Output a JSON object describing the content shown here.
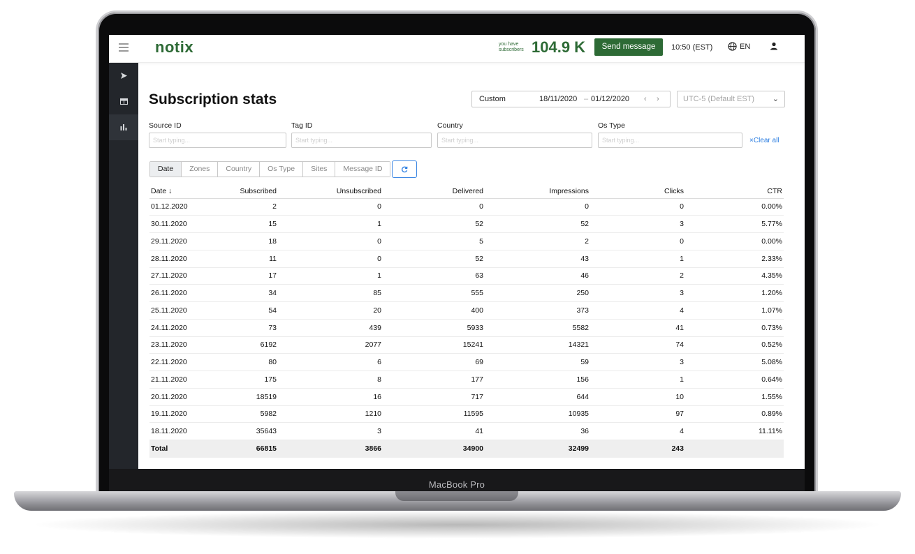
{
  "device": {
    "label": "MacBook Pro"
  },
  "header": {
    "logo": "notix",
    "subscribers_caption_line1": "you have",
    "subscribers_caption_line2": "subscribers",
    "subscribers_count": "104.9 K",
    "send_button": "Send message",
    "clock": "10:50 (EST)",
    "language": "EN"
  },
  "page": {
    "title": "Subscription stats"
  },
  "daterange": {
    "preset": "Custom",
    "from": "18/11/2020",
    "separator": "–",
    "to": "01/12/2020"
  },
  "timezone": {
    "value": "UTC-5 (Default EST)"
  },
  "filters": {
    "source_id": {
      "label": "Source ID",
      "placeholder": "Start typing..."
    },
    "tag_id": {
      "label": "Tag ID",
      "placeholder": "Start typing..."
    },
    "country": {
      "label": "Country",
      "placeholder": "Start typing..."
    },
    "os_type": {
      "label": "Os Type",
      "placeholder": "Start typing..."
    },
    "clear_all": "Clear all"
  },
  "tabs": [
    "Date",
    "Zones",
    "Country",
    "Os Type",
    "Sites",
    "Message ID"
  ],
  "table": {
    "columns": [
      "Date",
      "Subscribed",
      "Unsubscribed",
      "Delivered",
      "Impressions",
      "Clicks",
      "CTR"
    ],
    "rows": [
      [
        "01.12.2020",
        "2",
        "0",
        "0",
        "0",
        "0",
        "0.00%"
      ],
      [
        "30.11.2020",
        "15",
        "1",
        "52",
        "52",
        "3",
        "5.77%"
      ],
      [
        "29.11.2020",
        "18",
        "0",
        "5",
        "2",
        "0",
        "0.00%"
      ],
      [
        "28.11.2020",
        "11",
        "0",
        "52",
        "43",
        "1",
        "2.33%"
      ],
      [
        "27.11.2020",
        "17",
        "1",
        "63",
        "46",
        "2",
        "4.35%"
      ],
      [
        "26.11.2020",
        "34",
        "85",
        "555",
        "250",
        "3",
        "1.20%"
      ],
      [
        "25.11.2020",
        "54",
        "20",
        "400",
        "373",
        "4",
        "1.07%"
      ],
      [
        "24.11.2020",
        "73",
        "439",
        "5933",
        "5582",
        "41",
        "0.73%"
      ],
      [
        "23.11.2020",
        "6192",
        "2077",
        "15241",
        "14321",
        "74",
        "0.52%"
      ],
      [
        "22.11.2020",
        "80",
        "6",
        "69",
        "59",
        "3",
        "5.08%"
      ],
      [
        "21.11.2020",
        "175",
        "8",
        "177",
        "156",
        "1",
        "0.64%"
      ],
      [
        "20.11.2020",
        "18519",
        "16",
        "717",
        "644",
        "10",
        "1.55%"
      ],
      [
        "19.11.2020",
        "5982",
        "1210",
        "11595",
        "10935",
        "97",
        "0.89%"
      ],
      [
        "18.11.2020",
        "35643",
        "3",
        "41",
        "36",
        "4",
        "11.11%"
      ]
    ],
    "total": [
      "Total",
      "66815",
      "3866",
      "34900",
      "32499",
      "243",
      ""
    ]
  }
}
